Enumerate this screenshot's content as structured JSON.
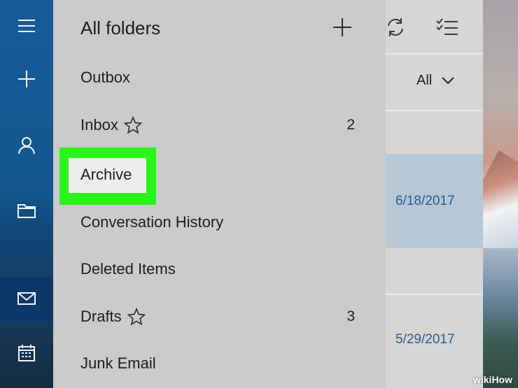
{
  "pane": {
    "title": "All folders"
  },
  "folders": [
    {
      "label": "Outbox",
      "starred": false,
      "count": ""
    },
    {
      "label": "Inbox",
      "starred": true,
      "count": "2"
    },
    {
      "label": "Archive",
      "starred": false,
      "count": "",
      "highlighted": true
    },
    {
      "label": "Conversation History",
      "starred": false,
      "count": ""
    },
    {
      "label": "Deleted Items",
      "starred": false,
      "count": ""
    },
    {
      "label": "Drafts",
      "starred": true,
      "count": "3"
    },
    {
      "label": "Junk Email",
      "starred": false,
      "count": ""
    }
  ],
  "message_list": {
    "filter_label": "All",
    "dates": [
      "6/18/2017",
      "5/29/2017"
    ]
  },
  "rail": {
    "items": [
      "menu-icon",
      "new-mail-icon",
      "people-icon",
      "folder-icon",
      "mail-icon",
      "calendar-icon"
    ]
  },
  "colors": {
    "highlight": "#29f51a",
    "date_text": "#2a5a8c"
  },
  "watermark": "wikiHow"
}
